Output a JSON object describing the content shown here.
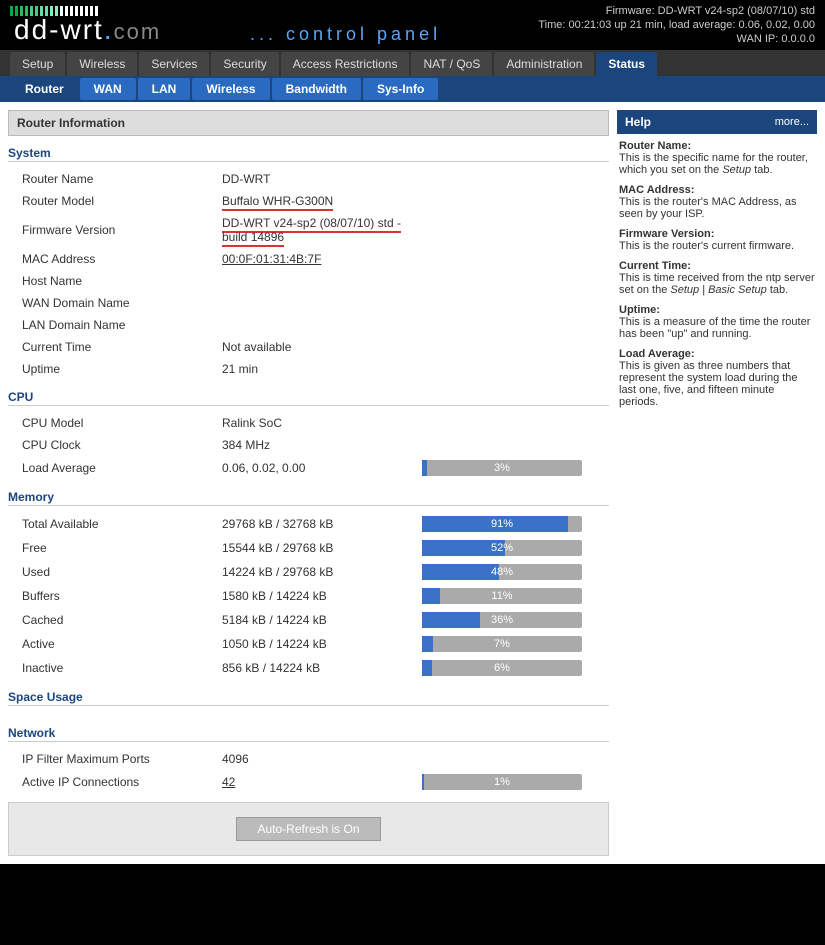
{
  "header": {
    "firmware": "Firmware: DD-WRT v24-sp2 (08/07/10) std",
    "time": "Time: 00:21:03 up 21 min, load average: 0.06, 0.02, 0.00",
    "wanip": "WAN IP: 0.0.0.0",
    "logo_a": "dd-",
    "logo_b": "wrt",
    "logo_c": ".com",
    "subtitle": "... control panel"
  },
  "maintabs": [
    "Setup",
    "Wireless",
    "Services",
    "Security",
    "Access Restrictions",
    "NAT / QoS",
    "Administration",
    "Status"
  ],
  "maintab_active": 7,
  "subtabs": [
    "Router",
    "WAN",
    "LAN",
    "Wireless",
    "Bandwidth",
    "Sys-Info"
  ],
  "subtab_active": 0,
  "panel_title": "Router Information",
  "help": {
    "title": "Help",
    "more": "more...",
    "items": [
      {
        "t": "Router Name:",
        "b": "This is the specific name for the router, which you set on the <i>Setup</i> tab."
      },
      {
        "t": "MAC Address:",
        "b": "This is the router's MAC Address, as seen by your ISP."
      },
      {
        "t": "Firmware Version:",
        "b": "This is the router's current firmware."
      },
      {
        "t": "Current Time:",
        "b": "This is time received from the ntp server set on the <i>Setup | Basic Setup</i> tab."
      },
      {
        "t": "Uptime:",
        "b": "This is a measure of the time the router has been \"up\" and running."
      },
      {
        "t": "Load Average:",
        "b": "This is given as three numbers that represent the system load during the last one, five, and fifteen minute periods."
      }
    ]
  },
  "sections": {
    "system": {
      "title": "System",
      "rows": [
        {
          "l": "Router Name",
          "v": "DD-WRT"
        },
        {
          "l": "Router Model",
          "v": "Buffalo WHR-G300N",
          "red": true
        },
        {
          "l": "Firmware Version",
          "v": "DD-WRT v24-sp2 (08/07/10) std - build 14896",
          "red": true
        },
        {
          "l": "MAC Address",
          "v": "00:0F:01:31:4B:7F",
          "link": true
        },
        {
          "l": "Host Name",
          "v": ""
        },
        {
          "l": "WAN Domain Name",
          "v": ""
        },
        {
          "l": "LAN Domain Name",
          "v": ""
        },
        {
          "l": "Current Time",
          "v": "Not available"
        },
        {
          "l": "Uptime",
          "v": "21 min"
        }
      ]
    },
    "cpu": {
      "title": "CPU",
      "rows": [
        {
          "l": "CPU Model",
          "v": "Ralink SoC"
        },
        {
          "l": "CPU Clock",
          "v": "384 MHz"
        },
        {
          "l": "Load Average",
          "v": "0.06, 0.02, 0.00",
          "bar": 3
        }
      ]
    },
    "memory": {
      "title": "Memory",
      "rows": [
        {
          "l": "Total Available",
          "v": "29768 kB / 32768 kB",
          "bar": 91
        },
        {
          "l": "Free",
          "v": "15544 kB / 29768 kB",
          "bar": 52
        },
        {
          "l": "Used",
          "v": "14224 kB / 29768 kB",
          "bar": 48
        },
        {
          "l": "Buffers",
          "v": "1580 kB / 14224 kB",
          "bar": 11
        },
        {
          "l": "Cached",
          "v": "5184 kB / 14224 kB",
          "bar": 36
        },
        {
          "l": "Active",
          "v": "1050 kB / 14224 kB",
          "bar": 7
        },
        {
          "l": "Inactive",
          "v": "856 kB / 14224 kB",
          "bar": 6
        }
      ]
    },
    "space": {
      "title": "Space Usage",
      "rows": []
    },
    "network": {
      "title": "Network",
      "rows": [
        {
          "l": "IP Filter Maximum Ports",
          "v": "4096"
        },
        {
          "l": "Active IP Connections",
          "v": "42",
          "link": true,
          "bar": 1
        }
      ]
    }
  },
  "autorefresh": "Auto-Refresh is On",
  "tick_colors": [
    "#0a4",
    "#0a4",
    "#2b6",
    "#2b6",
    "#4c8",
    "#4c8",
    "#6da",
    "#6da",
    "#8eb",
    "#8eb",
    "#fff",
    "#fff",
    "#fff",
    "#fff",
    "#fff",
    "#fff",
    "#fff",
    "#fff"
  ]
}
